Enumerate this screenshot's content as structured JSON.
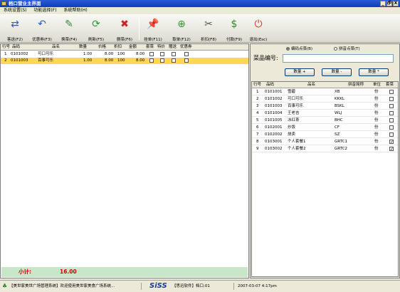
{
  "title": "档口营业主界面",
  "window_buttons": [
    "_",
    "🗗",
    "X"
  ],
  "menu": [
    "系统设置(S)",
    "功能选择(F)",
    "系统帮助(H)"
  ],
  "toolbar": [
    {
      "label": "客送(F2)",
      "icon": "⇄"
    },
    {
      "label": "优惠券(F3)",
      "icon": "↶"
    },
    {
      "label": "换菜(F4)",
      "icon": "✎"
    },
    {
      "label": "刷新(F5)",
      "icon": "⟳"
    },
    {
      "label": "删菜(F6)",
      "icon": "✖"
    },
    {
      "label": "挂单(F11)",
      "icon": "📌"
    },
    {
      "label": "取单(F12)",
      "icon": "⊕"
    },
    {
      "label": "折扣(F8)",
      "icon": "✂"
    },
    {
      "label": "付款(F9)",
      "icon": "$"
    },
    {
      "label": "退出(Esc)",
      "icon": "⏻"
    }
  ],
  "left_table": {
    "headers": [
      "行号",
      "品码",
      "品名",
      "数量",
      "价格",
      "折扣",
      "金额",
      "套菜",
      "特价",
      "赠送",
      "优惠券"
    ],
    "rows": [
      {
        "no": "1",
        "code": "0101002",
        "name": "可口可乐",
        "qty": "1.00",
        "price": "8.00",
        "disc": "100",
        "amount": "8.00",
        "checks": [
          false,
          false,
          false,
          false
        ]
      },
      {
        "no": "2",
        "code": "0101003",
        "name": "百事可乐",
        "qty": "1.00",
        "price": "8.00",
        "disc": "100",
        "amount": "8.00",
        "checks": [
          false,
          false,
          false,
          false
        ]
      }
    ]
  },
  "subtotal": {
    "label": "小计:",
    "value": "16.00"
  },
  "search": {
    "radio_code": "编码点菜(B)",
    "radio_pinyin": "拼音点菜(T)",
    "code_label": "菜品编号:",
    "code_value": "",
    "btn_plus": "数量 +",
    "btn_minus": "数量 -",
    "btn_mul": "数量 *"
  },
  "right_table": {
    "headers": [
      "行号",
      "品码",
      "品名",
      "拼音简称",
      "单位",
      "套菜"
    ],
    "rows": [
      {
        "no": "1",
        "code": "0101001",
        "name": "雪碧",
        "py": "XB",
        "unit": "份",
        "set": false
      },
      {
        "no": "2",
        "code": "0101002",
        "name": "可口可乐",
        "py": "KKKL",
        "unit": "份",
        "set": false
      },
      {
        "no": "3",
        "code": "0101003",
        "name": "百事可乐",
        "py": "BSKL",
        "unit": "份",
        "set": false
      },
      {
        "no": "4",
        "code": "0101004",
        "name": "王老吉",
        "py": "WLJ",
        "unit": "份",
        "set": false
      },
      {
        "no": "5",
        "code": "0101005",
        "name": "冰红茶",
        "py": "BHC",
        "unit": "份",
        "set": false
      },
      {
        "no": "6",
        "code": "0102001",
        "name": "炒饭",
        "py": "CF",
        "unit": "份",
        "set": false
      },
      {
        "no": "7",
        "code": "0102002",
        "name": "烧卖",
        "py": "SZ",
        "unit": "份",
        "set": false
      },
      {
        "no": "8",
        "code": "0103001",
        "name": "个人套餐1",
        "py": "GRTC1",
        "unit": "份",
        "set": true
      },
      {
        "no": "9",
        "code": "0103002",
        "name": "个人套餐2",
        "py": "GRTC2",
        "unit": "份",
        "set": true
      }
    ]
  },
  "status": {
    "left": "【美世家美世广场管理系统】欢迎使用美世家美食广场系统...",
    "logo": "SiSS",
    "company": "【思迅软件】档口:01",
    "datetime": "2007-03-07 4:17pm"
  }
}
